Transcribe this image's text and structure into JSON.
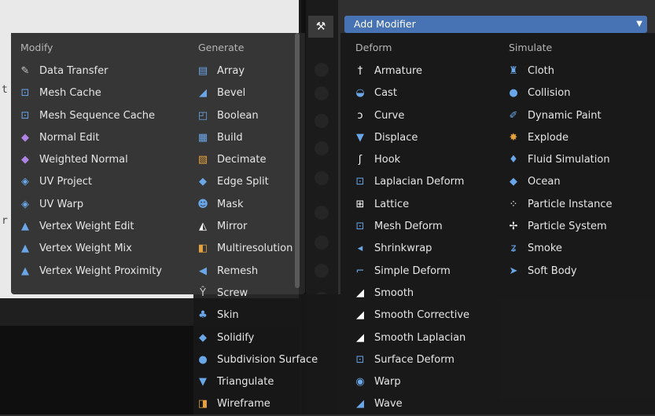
{
  "toolbar": {
    "tab_icon": "wrench-screwdriver-icon",
    "tab_glyph": "⚒"
  },
  "dropdown": {
    "label": "Add Modifier"
  },
  "background": {
    "fragment_1": "t",
    "fragment_2": "r"
  },
  "columns": {
    "modify": {
      "title": "Modify",
      "items": [
        {
          "label": "Data Transfer",
          "icon": "data-transfer-icon",
          "glyph": "✎"
        },
        {
          "label": "Mesh Cache",
          "icon": "mesh-cache-icon",
          "glyph": "⊡"
        },
        {
          "label": "Mesh Sequence Cache",
          "icon": "mesh-sequence-cache-icon",
          "glyph": "⊡"
        },
        {
          "label": "Normal Edit",
          "icon": "normal-edit-icon",
          "glyph": "◆"
        },
        {
          "label": "Weighted Normal",
          "icon": "weighted-normal-icon",
          "glyph": "◆"
        },
        {
          "label": "UV Project",
          "icon": "uv-project-icon",
          "glyph": "◈"
        },
        {
          "label": "UV Warp",
          "icon": "uv-warp-icon",
          "glyph": "◈"
        },
        {
          "label": "Vertex Weight Edit",
          "icon": "vertex-weight-edit-icon",
          "glyph": "▲"
        },
        {
          "label": "Vertex Weight Mix",
          "icon": "vertex-weight-mix-icon",
          "glyph": "▲"
        },
        {
          "label": "Vertex Weight Proximity",
          "icon": "vertex-weight-proximity-icon",
          "glyph": "▲"
        }
      ]
    },
    "generate": {
      "title": "Generate",
      "items": [
        {
          "label": "Array",
          "icon": "array-icon",
          "glyph": "▤"
        },
        {
          "label": "Bevel",
          "icon": "bevel-icon",
          "glyph": "◢"
        },
        {
          "label": "Boolean",
          "icon": "boolean-icon",
          "glyph": "◰"
        },
        {
          "label": "Build",
          "icon": "build-icon",
          "glyph": "▦"
        },
        {
          "label": "Decimate",
          "icon": "decimate-icon",
          "glyph": "▧"
        },
        {
          "label": "Edge Split",
          "icon": "edge-split-icon",
          "glyph": "◆"
        },
        {
          "label": "Mask",
          "icon": "mask-icon",
          "glyph": "☻"
        },
        {
          "label": "Mirror",
          "icon": "mirror-icon",
          "glyph": "◭"
        },
        {
          "label": "Multiresolution",
          "icon": "multiresolution-icon",
          "glyph": "◧"
        },
        {
          "label": "Remesh",
          "icon": "remesh-icon",
          "glyph": "◀"
        },
        {
          "label": "Screw",
          "icon": "screw-icon",
          "glyph": "Ŷ"
        },
        {
          "label": "Skin",
          "icon": "skin-icon",
          "glyph": "♣"
        },
        {
          "label": "Solidify",
          "icon": "solidify-icon",
          "glyph": "◆"
        },
        {
          "label": "Subdivision Surface",
          "icon": "subdivision-surface-icon",
          "glyph": "●"
        },
        {
          "label": "Triangulate",
          "icon": "triangulate-icon",
          "glyph": "▼"
        },
        {
          "label": "Wireframe",
          "icon": "wireframe-icon",
          "glyph": "◨"
        }
      ]
    },
    "deform": {
      "title": "Deform",
      "items": [
        {
          "label": "Armature",
          "icon": "armature-icon",
          "glyph": "†"
        },
        {
          "label": "Cast",
          "icon": "cast-icon",
          "glyph": "◒"
        },
        {
          "label": "Curve",
          "icon": "curve-icon",
          "glyph": "ↄ"
        },
        {
          "label": "Displace",
          "icon": "displace-icon",
          "glyph": "▼"
        },
        {
          "label": "Hook",
          "icon": "hook-icon",
          "glyph": "ʃ"
        },
        {
          "label": "Laplacian Deform",
          "icon": "laplacian-deform-icon",
          "glyph": "⊡"
        },
        {
          "label": "Lattice",
          "icon": "lattice-icon",
          "glyph": "⊞"
        },
        {
          "label": "Mesh Deform",
          "icon": "mesh-deform-icon",
          "glyph": "⊡"
        },
        {
          "label": "Shrinkwrap",
          "icon": "shrinkwrap-icon",
          "glyph": "◂"
        },
        {
          "label": "Simple Deform",
          "icon": "simple-deform-icon",
          "glyph": "⌐"
        },
        {
          "label": "Smooth",
          "icon": "smooth-icon",
          "glyph": "◢"
        },
        {
          "label": "Smooth Corrective",
          "icon": "smooth-corrective-icon",
          "glyph": "◢"
        },
        {
          "label": "Smooth Laplacian",
          "icon": "smooth-laplacian-icon",
          "glyph": "◢"
        },
        {
          "label": "Surface Deform",
          "icon": "surface-deform-icon",
          "glyph": "⊡"
        },
        {
          "label": "Warp",
          "icon": "warp-icon",
          "glyph": "◉"
        },
        {
          "label": "Wave",
          "icon": "wave-icon",
          "glyph": "◢"
        }
      ]
    },
    "simulate": {
      "title": "Simulate",
      "items": [
        {
          "label": "Cloth",
          "icon": "cloth-icon",
          "glyph": "♜"
        },
        {
          "label": "Collision",
          "icon": "collision-icon",
          "glyph": "●"
        },
        {
          "label": "Dynamic Paint",
          "icon": "dynamic-paint-icon",
          "glyph": "✐"
        },
        {
          "label": "Explode",
          "icon": "explode-icon",
          "glyph": "✸"
        },
        {
          "label": "Fluid Simulation",
          "icon": "fluid-simulation-icon",
          "glyph": "♦"
        },
        {
          "label": "Ocean",
          "icon": "ocean-icon",
          "glyph": "◆"
        },
        {
          "label": "Particle Instance",
          "icon": "particle-instance-icon",
          "glyph": "⁘"
        },
        {
          "label": "Particle System",
          "icon": "particle-system-icon",
          "glyph": "✢"
        },
        {
          "label": "Smoke",
          "icon": "smoke-icon",
          "glyph": "ʑ"
        },
        {
          "label": "Soft Body",
          "icon": "soft-body-icon",
          "glyph": "➤"
        }
      ]
    }
  }
}
